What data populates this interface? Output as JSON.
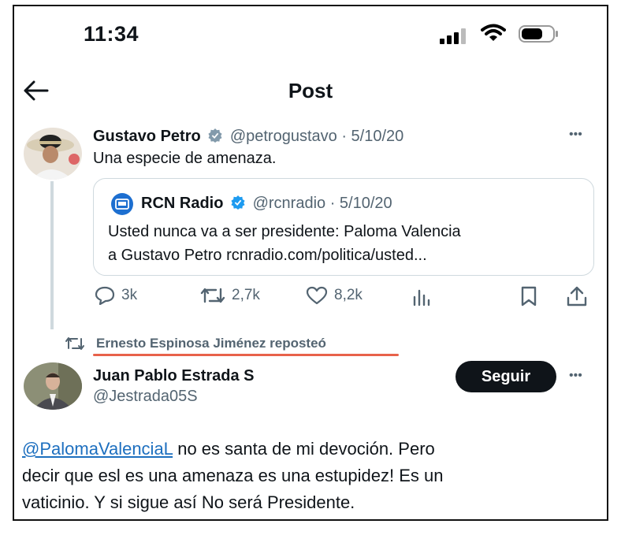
{
  "status_bar": {
    "time": "11:34"
  },
  "header": {
    "title": "Post"
  },
  "original_post": {
    "author_name": "Gustavo Petro",
    "handle": "@petrogustavo",
    "date": "· 5/10/20",
    "text": "Una especie de amenaza.",
    "more": "•••",
    "quote": {
      "source_name": "RCN Radio",
      "handle": "@rcnradio",
      "date": "· 5/10/20",
      "text_line1": "Usted nunca va a ser presidente: Paloma Valencia",
      "text_line2": "a Gustavo Petro rcnradio.com/politica/usted..."
    },
    "actions": {
      "replies": "3k",
      "reposts": "2,7k",
      "likes": "8,2k"
    }
  },
  "repost_notice": "Ernesto Espinosa Jiménez reposteó",
  "reply_post": {
    "author_name": "Juan Pablo Estrada S",
    "handle": "@Jestrada05S",
    "follow_label": "Seguir",
    "more": "•••",
    "mention": "@PalomaValenciaL",
    "text_after_mention": " no es santa de mi devoción. Pero",
    "text_line2": "decir que esl es una amenaza es una estupidez! Es un",
    "text_line3": "vaticinio. Y si sigue así No será Presidente."
  },
  "colors": {
    "accent_blue": "#1d9bf0",
    "underline": "#e8624a",
    "text": "#0f1419",
    "muted": "#536471"
  }
}
